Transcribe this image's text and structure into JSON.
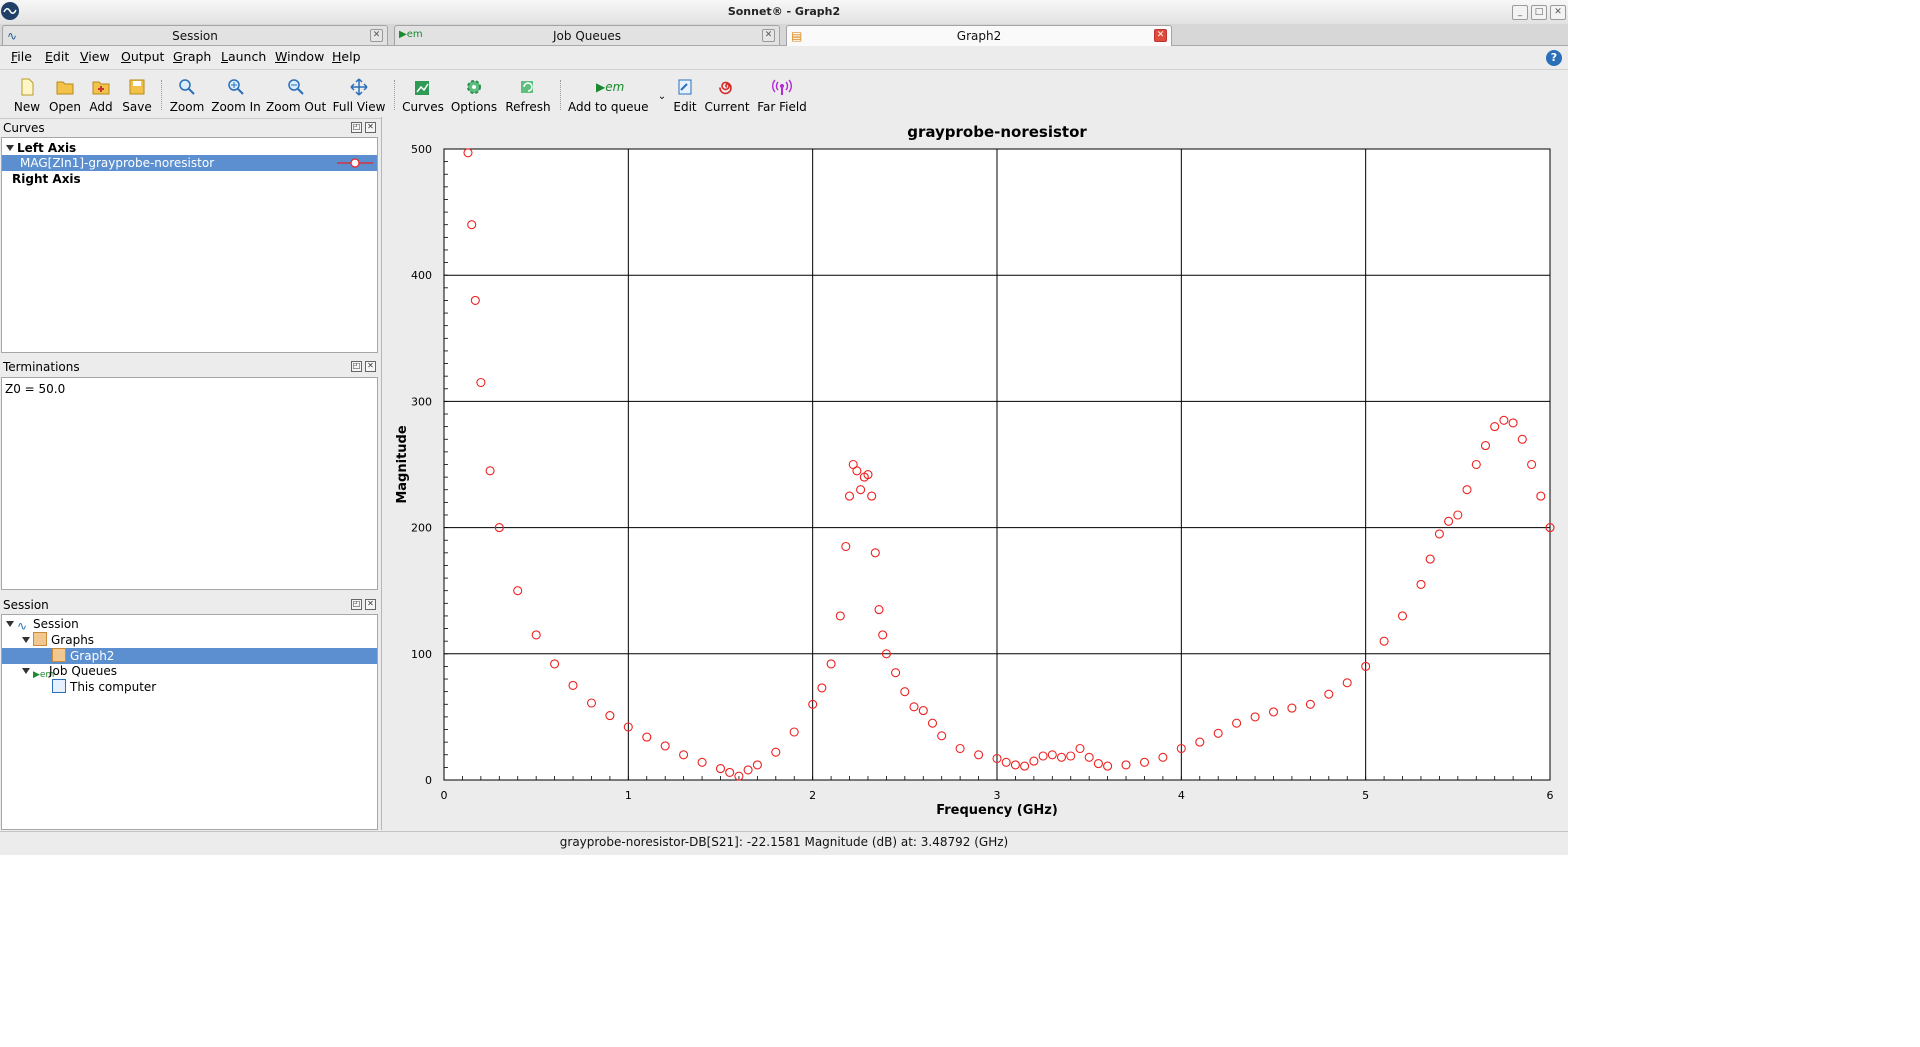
{
  "window": {
    "title": "Sonnet® - Graph2"
  },
  "tabs": [
    {
      "label": "Session",
      "icon": "session-icon"
    },
    {
      "label": "Job Queues",
      "icon": "em-icon"
    },
    {
      "label": "Graph2",
      "icon": "graph-icon",
      "active": true
    }
  ],
  "menu": [
    {
      "label": "File",
      "u": "F",
      "rest": "ile"
    },
    {
      "label": "Edit",
      "u": "E",
      "rest": "dit"
    },
    {
      "label": "View",
      "u": "V",
      "rest": "iew"
    },
    {
      "label": "Output",
      "u": "O",
      "rest": "utput"
    },
    {
      "label": "Graph",
      "u": "G",
      "rest": "raph"
    },
    {
      "label": "Launch",
      "u": "L",
      "rest": "aunch"
    },
    {
      "label": "Window",
      "u": "W",
      "rest": "indow"
    },
    {
      "label": "Help",
      "u": "H",
      "rest": "elp"
    }
  ],
  "toolbar": {
    "new": "New",
    "open": "Open",
    "add": "Add",
    "save": "Save",
    "zoom": "Zoom",
    "zoom_in": "Zoom In",
    "zoom_out": "Zoom Out",
    "full_view": "Full View",
    "curves": "Curves",
    "options": "Options",
    "refresh": "Refresh",
    "add_to_queue": "Add to queue",
    "edit": "Edit",
    "current": "Current",
    "far_field": "Far Field"
  },
  "curves_pane": {
    "title": "Curves",
    "left_axis": "Left Axis",
    "curve_item": "MAG[ZIn1]-grayprobe-noresistor",
    "right_axis": "Right Axis"
  },
  "terminations_pane": {
    "title": "Terminations",
    "z0": "Z0 = 50.0"
  },
  "session_pane": {
    "title": "Session",
    "session": "Session",
    "graphs": "Graphs",
    "graph2": "Graph2",
    "job_queues": "Job Queues",
    "this_computer": "This computer"
  },
  "colors": {
    "curve": "#ee2222",
    "selection": "#5b8fd0"
  },
  "chart_data": {
    "type": "scatter",
    "title": "grayprobe-noresistor",
    "xlabel": "Frequency (GHz)",
    "ylabel": "Magnitude",
    "xlim": [
      0,
      6
    ],
    "ylim": [
      0,
      500
    ],
    "xticks": [
      "0",
      "1",
      "2",
      "3",
      "4",
      "5",
      "6"
    ],
    "yticks": [
      "0",
      "100",
      "200",
      "300",
      "400",
      "500"
    ],
    "grid": true,
    "series": [
      {
        "name": "MAG[ZIn1]-grayprobe-noresistor",
        "color": "#ee2222",
        "x": [
          0.13,
          0.15,
          0.17,
          0.2,
          0.25,
          0.3,
          0.4,
          0.5,
          0.6,
          0.7,
          0.8,
          0.9,
          1.0,
          1.1,
          1.2,
          1.3,
          1.4,
          1.5,
          1.55,
          1.6,
          1.65,
          1.7,
          1.8,
          1.9,
          2.0,
          2.05,
          2.1,
          2.15,
          2.18,
          2.2,
          2.22,
          2.24,
          2.26,
          2.28,
          2.3,
          2.32,
          2.34,
          2.36,
          2.38,
          2.4,
          2.45,
          2.5,
          2.55,
          2.6,
          2.65,
          2.7,
          2.8,
          2.9,
          3.0,
          3.05,
          3.1,
          3.15,
          3.2,
          3.25,
          3.3,
          3.35,
          3.4,
          3.45,
          3.5,
          3.55,
          3.6,
          3.7,
          3.8,
          3.9,
          4.0,
          4.1,
          4.2,
          4.3,
          4.4,
          4.5,
          4.6,
          4.7,
          4.8,
          4.9,
          5.0,
          5.1,
          5.2,
          5.3,
          5.35,
          5.4,
          5.45,
          5.5,
          5.55,
          5.6,
          5.65,
          5.7,
          5.75,
          5.8,
          5.85,
          5.9,
          5.95,
          6.0
        ],
        "y": [
          497,
          440,
          380,
          315,
          245,
          200,
          150,
          115,
          92,
          75,
          61,
          51,
          42,
          34,
          27,
          20,
          14,
          9,
          6,
          3,
          8,
          12,
          22,
          38,
          60,
          73,
          92,
          130,
          185,
          225,
          250,
          245,
          230,
          240,
          242,
          225,
          180,
          135,
          115,
          100,
          85,
          70,
          58,
          55,
          45,
          35,
          25,
          20,
          17,
          14,
          12,
          11,
          15,
          19,
          20,
          18,
          19,
          25,
          18,
          13,
          11,
          12,
          14,
          18,
          25,
          30,
          37,
          45,
          50,
          54,
          57,
          60,
          68,
          77,
          90,
          110,
          130,
          155,
          175,
          195,
          205,
          210,
          230,
          250,
          265,
          280,
          285,
          283,
          270,
          250,
          225,
          200
        ]
      }
    ]
  },
  "status": {
    "text": "grayprobe-noresistor-DB[S21]: -22.1581 Magnitude (dB) at: 3.48792 (GHz)"
  }
}
